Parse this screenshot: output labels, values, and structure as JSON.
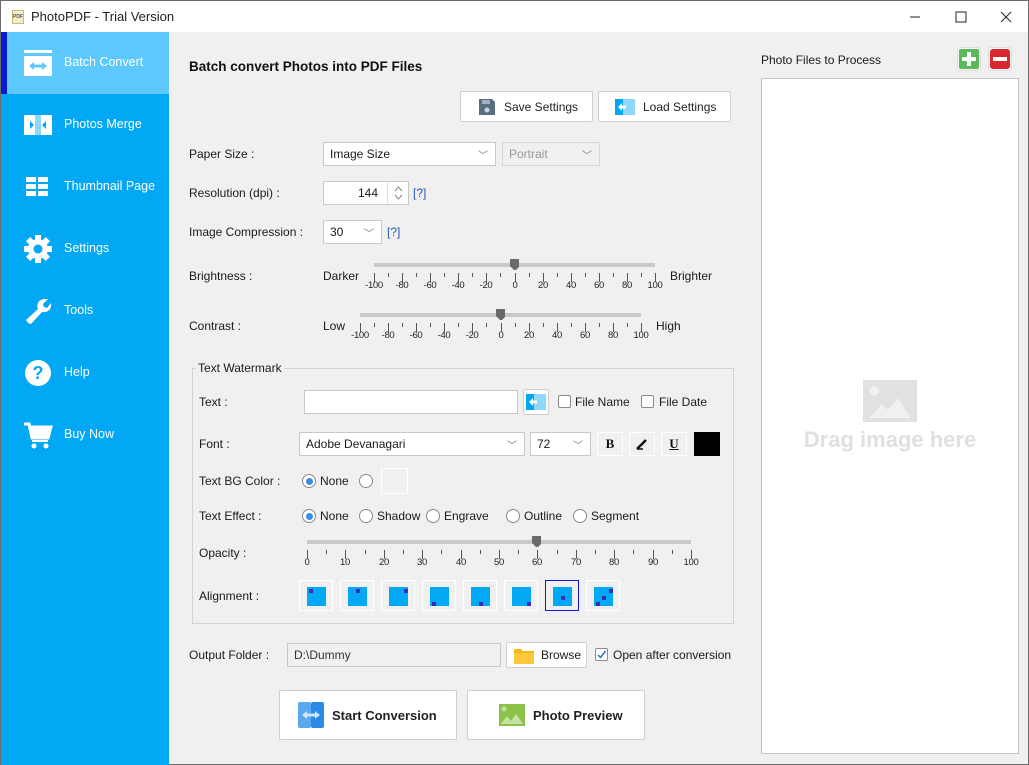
{
  "window": {
    "title": "PhotoPDF - Trial Version",
    "app_icon_text": "PDF",
    "controls": {
      "minimize": "—",
      "maximize": "☐",
      "close": "✕"
    }
  },
  "sidebar": {
    "items": [
      {
        "label": "Batch Convert",
        "icon": "convert-arrows-icon",
        "active": true
      },
      {
        "label": "Photos Merge",
        "icon": "merge-icon",
        "active": false
      },
      {
        "label": "Thumbnail Page",
        "icon": "grid-icon",
        "active": false
      },
      {
        "label": "Settings",
        "icon": "gear-icon",
        "active": false
      },
      {
        "label": "Tools",
        "icon": "wrench-icon",
        "active": false
      },
      {
        "label": "Help",
        "icon": "question-icon",
        "active": false
      },
      {
        "label": "Buy Now",
        "icon": "cart-icon",
        "active": false
      }
    ]
  },
  "main": {
    "title": "Batch convert Photos into PDF Files",
    "save_settings": "Save Settings",
    "load_settings": "Load Settings",
    "paper_size": {
      "label": "Paper Size :",
      "value": "Image Size",
      "orientation": "Portrait"
    },
    "resolution": {
      "label": "Resolution (dpi) :",
      "value": "144",
      "help": "[?]"
    },
    "compression": {
      "label": "Image Compression :",
      "value": "30",
      "help": "[?]"
    },
    "brightness": {
      "label": "Brightness :",
      "left": "Darker",
      "right": "Brighter",
      "value": 0,
      "min": -100,
      "max": 100,
      "ticks": [
        "-100",
        "-80",
        "-60",
        "-40",
        "-20",
        "0",
        "20",
        "40",
        "60",
        "80",
        "100"
      ]
    },
    "contrast": {
      "label": "Contrast :",
      "left": "Low",
      "right": "High",
      "value": 0,
      "min": -100,
      "max": 100,
      "ticks": [
        "-100",
        "-80",
        "-60",
        "-40",
        "-20",
        "0",
        "20",
        "40",
        "60",
        "80",
        "100"
      ]
    },
    "watermark": {
      "group_title": "Text Watermark",
      "text_label": "Text :",
      "text_value": "",
      "file_name": "File Name",
      "file_name_checked": false,
      "file_date": "File Date",
      "file_date_checked": false,
      "font_label": "Font :",
      "font_value": "Adobe Devanagari",
      "font_size": "72",
      "bold": "B",
      "italic": "I",
      "underline": "U",
      "text_color": "#000000",
      "bg_label": "Text BG Color :",
      "bg_none": "None",
      "bg_selected": "None",
      "effect_label": "Text Effect  :",
      "effects": [
        "None",
        "Shadow",
        "Engrave",
        "Outline",
        "Segment"
      ],
      "effect_selected": "None",
      "opacity_label": "Opacity :",
      "opacity_value": 60,
      "opacity_ticks": [
        "0",
        "10",
        "20",
        "30",
        "40",
        "50",
        "60",
        "70",
        "80",
        "90",
        "100"
      ],
      "alignment_label": "Alignment :",
      "alignments": [
        "top-left",
        "top-center",
        "top-right",
        "bottom-left",
        "bottom-center",
        "bottom-right",
        "center",
        "diagonal"
      ],
      "alignment_selected": "center"
    },
    "output": {
      "label": "Output Folder :",
      "value": "D:\\Dummy",
      "browse": "Browse",
      "open_after": "Open after conversion",
      "open_after_checked": true
    },
    "start_conversion": "Start Conversion",
    "photo_preview": "Photo Preview"
  },
  "files_panel": {
    "title": "Photo Files to Process",
    "placeholder": "Drag image here"
  },
  "colors": {
    "sidebar_bg": "#02a8f4",
    "sidebar_active": "#5cc8fc",
    "active_indicator": "#0b17d7",
    "add_green": "#5cb85c",
    "remove_red": "#d9272e"
  }
}
